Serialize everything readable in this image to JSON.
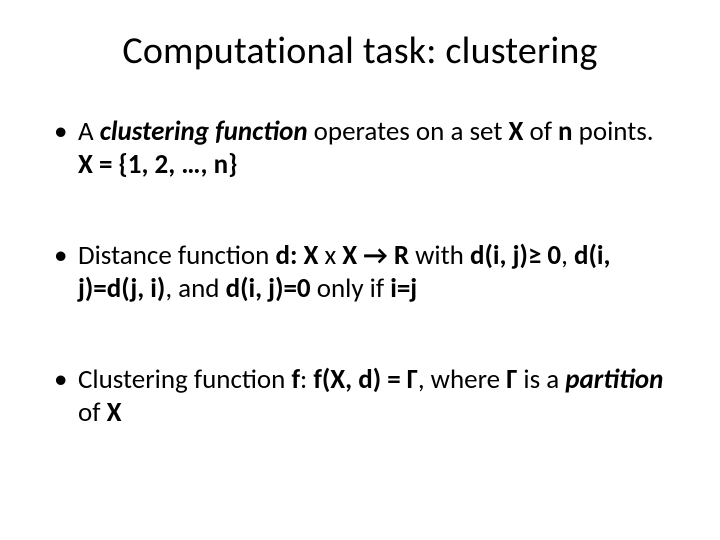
{
  "title": "Computational task: clustering",
  "bullets": {
    "b1": {
      "t1": "A ",
      "t2": "clustering function",
      "t3": " operates on a set ",
      "t4": "X",
      "t5": " of ",
      "t6": "n",
      "t7": " points.  ",
      "t8": "X = {1, 2, …, n}"
    },
    "b2": {
      "t1": "Distance function ",
      "t2": "d: X",
      "t3": " x ",
      "t4": "X ",
      "t5": "→",
      "t6": " R",
      "t7": " with ",
      "t8": "d(i, j)≥ 0",
      "t9": ", ",
      "t10": "d(i, j)=d(j, i)",
      "t11": ", and ",
      "t12": "d(i, j)=0 ",
      "t13": "only if ",
      "t14": "i=j"
    },
    "b3": {
      "t1": "Clustering function ",
      "t2": "f",
      "t3": ": ",
      "t4": "f(X, d) = Γ",
      "t5": ", where ",
      "t6": "Γ",
      "t7": " is a ",
      "t8": "partition",
      "t9": " of ",
      "t10": "X"
    }
  }
}
